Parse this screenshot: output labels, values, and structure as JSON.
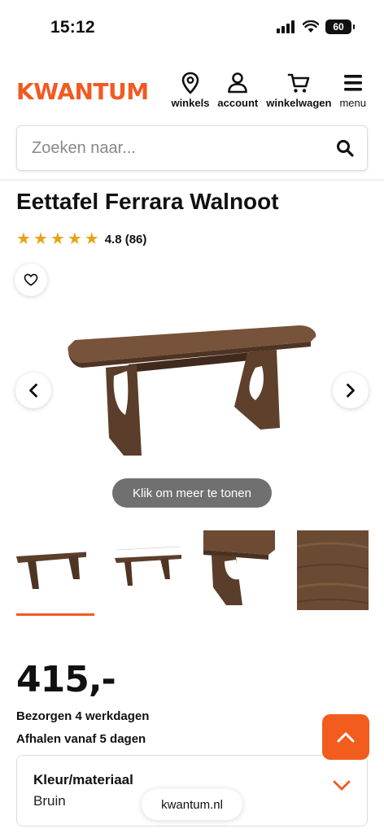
{
  "status_bar": {
    "time": "15:12",
    "battery": "60"
  },
  "header": {
    "logo": "KWANTUM",
    "nav": [
      {
        "label": "winkels",
        "icon": "location-pin-icon"
      },
      {
        "label": "account",
        "icon": "user-icon"
      },
      {
        "label": "winkelwagen",
        "icon": "cart-icon"
      },
      {
        "label": "menu",
        "icon": "hamburger-icon"
      }
    ]
  },
  "search": {
    "placeholder": "Zoeken naar..."
  },
  "product": {
    "title": "Eettafel Ferrara Walnoot",
    "rating": 4.8,
    "rating_text": "4.8 (86)",
    "more_button": "Klik om meer te tonen",
    "thumbnail_count": 4,
    "selected_thumbnail": 1,
    "price": "415,-",
    "delivery": "Bezorgen 4 werkdagen",
    "pickup": "Afhalen vanaf 5 dagen",
    "option": {
      "title": "Kleur/materiaal",
      "value": "Bruin"
    }
  },
  "browser": {
    "url": "kwantum.nl"
  },
  "colors": {
    "brand": "#f15a22",
    "star": "#e8a317",
    "wood": "#6b4a33"
  }
}
